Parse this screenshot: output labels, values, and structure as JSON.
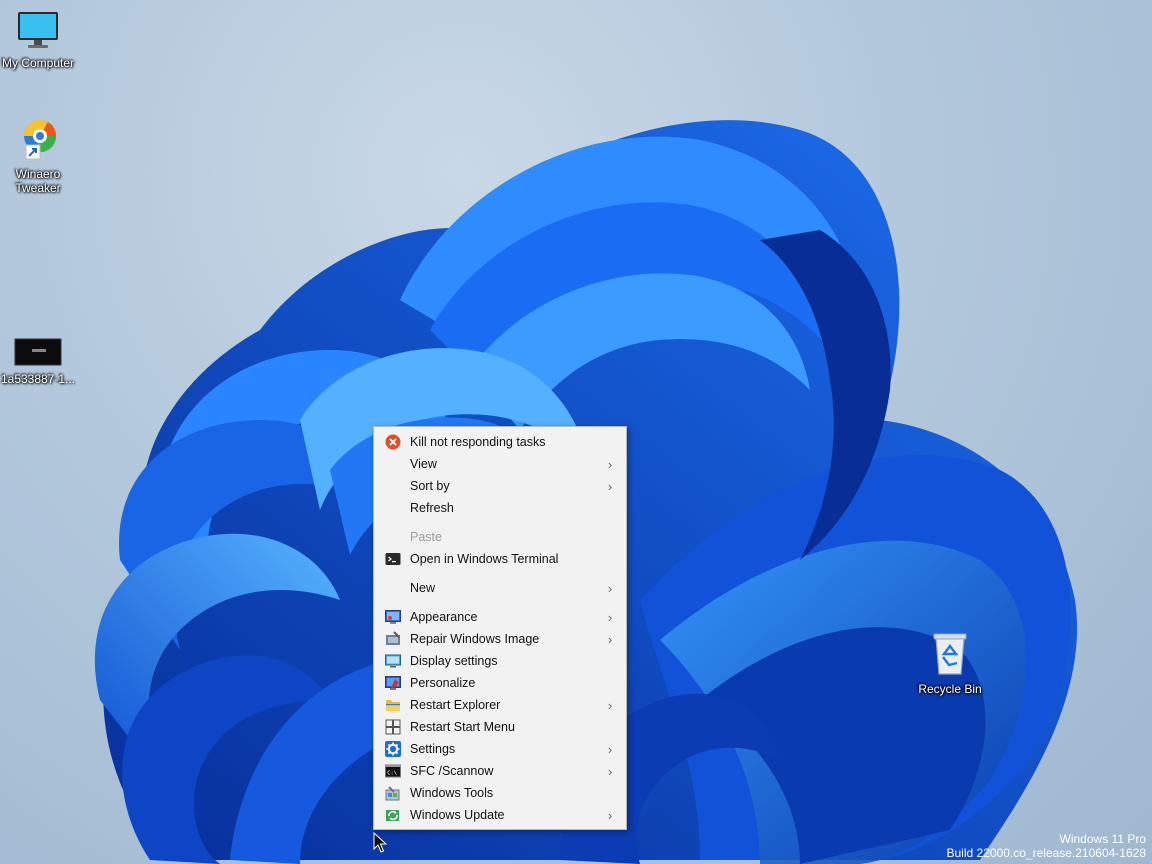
{
  "desktop": {
    "icons": [
      {
        "label": "My Computer",
        "icon": "monitor-icon"
      },
      {
        "label": "Winaero Tweaker",
        "icon": "winaero-tweaker-icon"
      },
      {
        "label": "1a533887-1...",
        "icon": "image-file-icon"
      },
      {
        "label": "Recycle Bin",
        "icon": "recycle-bin-icon"
      }
    ]
  },
  "context_menu": {
    "items": [
      {
        "label": "Kill not responding tasks",
        "icon": "kill-task-icon",
        "submenu": false,
        "enabled": true
      },
      {
        "label": "View",
        "icon": "",
        "submenu": true,
        "enabled": true
      },
      {
        "label": "Sort by",
        "icon": "",
        "submenu": true,
        "enabled": true
      },
      {
        "label": "Refresh",
        "icon": "",
        "submenu": false,
        "enabled": true
      },
      {
        "label": "Paste",
        "icon": "",
        "submenu": false,
        "enabled": false
      },
      {
        "label": "Open in Windows Terminal",
        "icon": "terminal-icon",
        "submenu": false,
        "enabled": true
      },
      {
        "label": "New",
        "icon": "",
        "submenu": true,
        "enabled": true
      },
      {
        "label": "Appearance",
        "icon": "appearance-icon",
        "submenu": true,
        "enabled": true
      },
      {
        "label": "Repair Windows Image",
        "icon": "repair-image-icon",
        "submenu": true,
        "enabled": true
      },
      {
        "label": "Display settings",
        "icon": "display-settings-icon",
        "submenu": false,
        "enabled": true
      },
      {
        "label": "Personalize",
        "icon": "personalize-icon",
        "submenu": false,
        "enabled": true
      },
      {
        "label": "Restart Explorer",
        "icon": "folder-icon",
        "submenu": true,
        "enabled": true
      },
      {
        "label": "Restart Start Menu",
        "icon": "start-menu-icon",
        "submenu": false,
        "enabled": true
      },
      {
        "label": "Settings",
        "icon": "gear-icon",
        "submenu": true,
        "enabled": true
      },
      {
        "label": "SFC /Scannow",
        "icon": "command-prompt-icon",
        "submenu": true,
        "enabled": true
      },
      {
        "label": "Windows Tools",
        "icon": "windows-tools-icon",
        "submenu": false,
        "enabled": true
      },
      {
        "label": "Windows Update",
        "icon": "windows-update-icon",
        "submenu": true,
        "enabled": true
      }
    ],
    "submenu_arrow": "›"
  },
  "watermark": {
    "edition": "Windows 11 Pro",
    "build": "Build 22000.co_release.210604-1628"
  },
  "colors": {
    "wallpaper_bg": "#b3c8dc",
    "bloom_dark": "#0b3fb8",
    "bloom_light": "#2f8cff",
    "menu_bg": "#f2f2f2"
  }
}
